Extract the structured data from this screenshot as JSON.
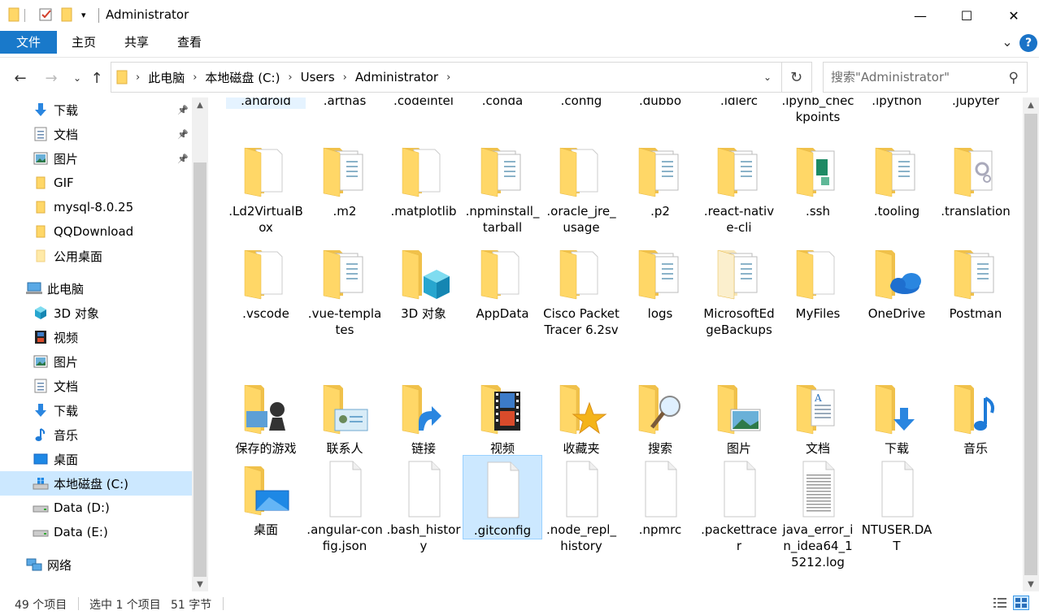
{
  "window": {
    "title": "Administrator"
  },
  "window_controls": {
    "minimize": "—",
    "maximize": "☐",
    "close": "✕"
  },
  "ribbon": {
    "tabs": [
      "文件",
      "主页",
      "共享",
      "查看"
    ],
    "collapse_chevron": "⌄",
    "help": "?"
  },
  "nav": {
    "back": "←",
    "forward": "→",
    "recent": "⌄",
    "up": "↑",
    "breadcrumb": [
      "此电脑",
      "本地磁盘 (C:)",
      "Users",
      "Administrator"
    ],
    "search_placeholder": "搜索\"Administrator\""
  },
  "sidebar": {
    "items": [
      {
        "label": "下载",
        "icon": "download-arrow-icon",
        "pinned": true
      },
      {
        "label": "文档",
        "icon": "document-icon",
        "pinned": true
      },
      {
        "label": "图片",
        "icon": "picture-icon",
        "pinned": true
      },
      {
        "label": "GIF",
        "icon": "folder-icon"
      },
      {
        "label": "mysql-8.0.25",
        "icon": "folder-icon"
      },
      {
        "label": "QQDownload",
        "icon": "folder-icon"
      },
      {
        "label": "公用桌面",
        "icon": "folder-pale-icon"
      },
      {
        "label": "此电脑",
        "icon": "computer-icon"
      },
      {
        "label": "3D 对象",
        "icon": "cube-3d-icon"
      },
      {
        "label": "视频",
        "icon": "film-icon"
      },
      {
        "label": "图片",
        "icon": "picture-icon"
      },
      {
        "label": "文档",
        "icon": "document-icon"
      },
      {
        "label": "下载",
        "icon": "download-arrow-icon"
      },
      {
        "label": "音乐",
        "icon": "music-note-icon"
      },
      {
        "label": "桌面",
        "icon": "desktop-icon"
      },
      {
        "label": "本地磁盘 (C:)",
        "icon": "windows-drive-icon",
        "selected": true
      },
      {
        "label": "Data (D:)",
        "icon": "drive-icon"
      },
      {
        "label": "Data (E:)",
        "icon": "drive-icon"
      },
      {
        "label": "网络",
        "icon": "network-icon"
      }
    ]
  },
  "files": [
    {
      "name": ".android",
      "kind": "folder-partial",
      "selected_partial": true
    },
    {
      "name": ".arthas",
      "kind": "folder-partial"
    },
    {
      "name": ".codeintel",
      "kind": "folder-partial"
    },
    {
      "name": ".conda",
      "kind": "folder-partial"
    },
    {
      "name": ".config",
      "kind": "folder-partial"
    },
    {
      "name": ".dubbo",
      "kind": "folder-partial"
    },
    {
      "name": ".idlerc",
      "kind": "folder-partial"
    },
    {
      "name": ".ipynb_checkpoints",
      "kind": "folder-partial"
    },
    {
      "name": ".ipython",
      "kind": "folder-partial"
    },
    {
      "name": ".jupyter",
      "kind": "folder-partial"
    },
    {
      "name": ".Ld2VirtualBox",
      "kind": "folder-paper"
    },
    {
      "name": ".m2",
      "kind": "folder-docs"
    },
    {
      "name": ".matplotlib",
      "kind": "folder-paper"
    },
    {
      "name": ".npminstall_tarball",
      "kind": "folder-docs"
    },
    {
      "name": ".oracle_jre_usage",
      "kind": "folder-paper"
    },
    {
      "name": ".p2",
      "kind": "folder-docs"
    },
    {
      "name": ".react-native-cli",
      "kind": "folder-docs"
    },
    {
      "name": ".ssh",
      "kind": "folder-green"
    },
    {
      "name": ".tooling",
      "kind": "folder-docs"
    },
    {
      "name": ".translation",
      "kind": "folder-gear"
    },
    {
      "name": ".vscode",
      "kind": "folder-paper"
    },
    {
      "name": ".vue-templates",
      "kind": "folder-docs"
    },
    {
      "name": "3D 对象",
      "kind": "folder-3d"
    },
    {
      "name": "AppData",
      "kind": "folder-paper"
    },
    {
      "name": "Cisco Packet Tracer 6.2sv",
      "kind": "folder-paper"
    },
    {
      "name": "logs",
      "kind": "folder-docs"
    },
    {
      "name": "MicrosoftEdgeBackups",
      "kind": "folder-faded"
    },
    {
      "name": "MyFiles",
      "kind": "folder-paper"
    },
    {
      "name": "OneDrive",
      "kind": "folder-cloud"
    },
    {
      "name": "Postman",
      "kind": "folder-docs"
    },
    {
      "name": "保存的游戏",
      "kind": "folder-games"
    },
    {
      "name": "联系人",
      "kind": "folder-contact"
    },
    {
      "name": "链接",
      "kind": "folder-link"
    },
    {
      "name": "视频",
      "kind": "folder-video"
    },
    {
      "name": "收藏夹",
      "kind": "folder-star"
    },
    {
      "name": "搜索",
      "kind": "folder-search"
    },
    {
      "name": "图片",
      "kind": "folder-picture"
    },
    {
      "name": "文档",
      "kind": "folder-document"
    },
    {
      "name": "下载",
      "kind": "folder-download"
    },
    {
      "name": "音乐",
      "kind": "folder-music"
    },
    {
      "name": "桌面",
      "kind": "folder-desktop"
    },
    {
      "name": ".angular-config.json",
      "kind": "file"
    },
    {
      "name": ".bash_history",
      "kind": "file"
    },
    {
      "name": ".gitconfig",
      "kind": "file",
      "selected": true
    },
    {
      "name": ".node_repl_history",
      "kind": "file"
    },
    {
      "name": ".npmrc",
      "kind": "file"
    },
    {
      "name": ".packettracer",
      "kind": "file"
    },
    {
      "name": "java_error_in_idea64_15212.log",
      "kind": "file-text"
    },
    {
      "name": "NTUSER.DAT",
      "kind": "file"
    }
  ],
  "status": {
    "item_count": "49 个项目",
    "selection": "选中 1 个项目",
    "size": "51 字节"
  },
  "colors": {
    "accent": "#1979ca",
    "selection": "#cce8ff",
    "folder": "#ffd767",
    "folder_dark": "#e8b840"
  }
}
